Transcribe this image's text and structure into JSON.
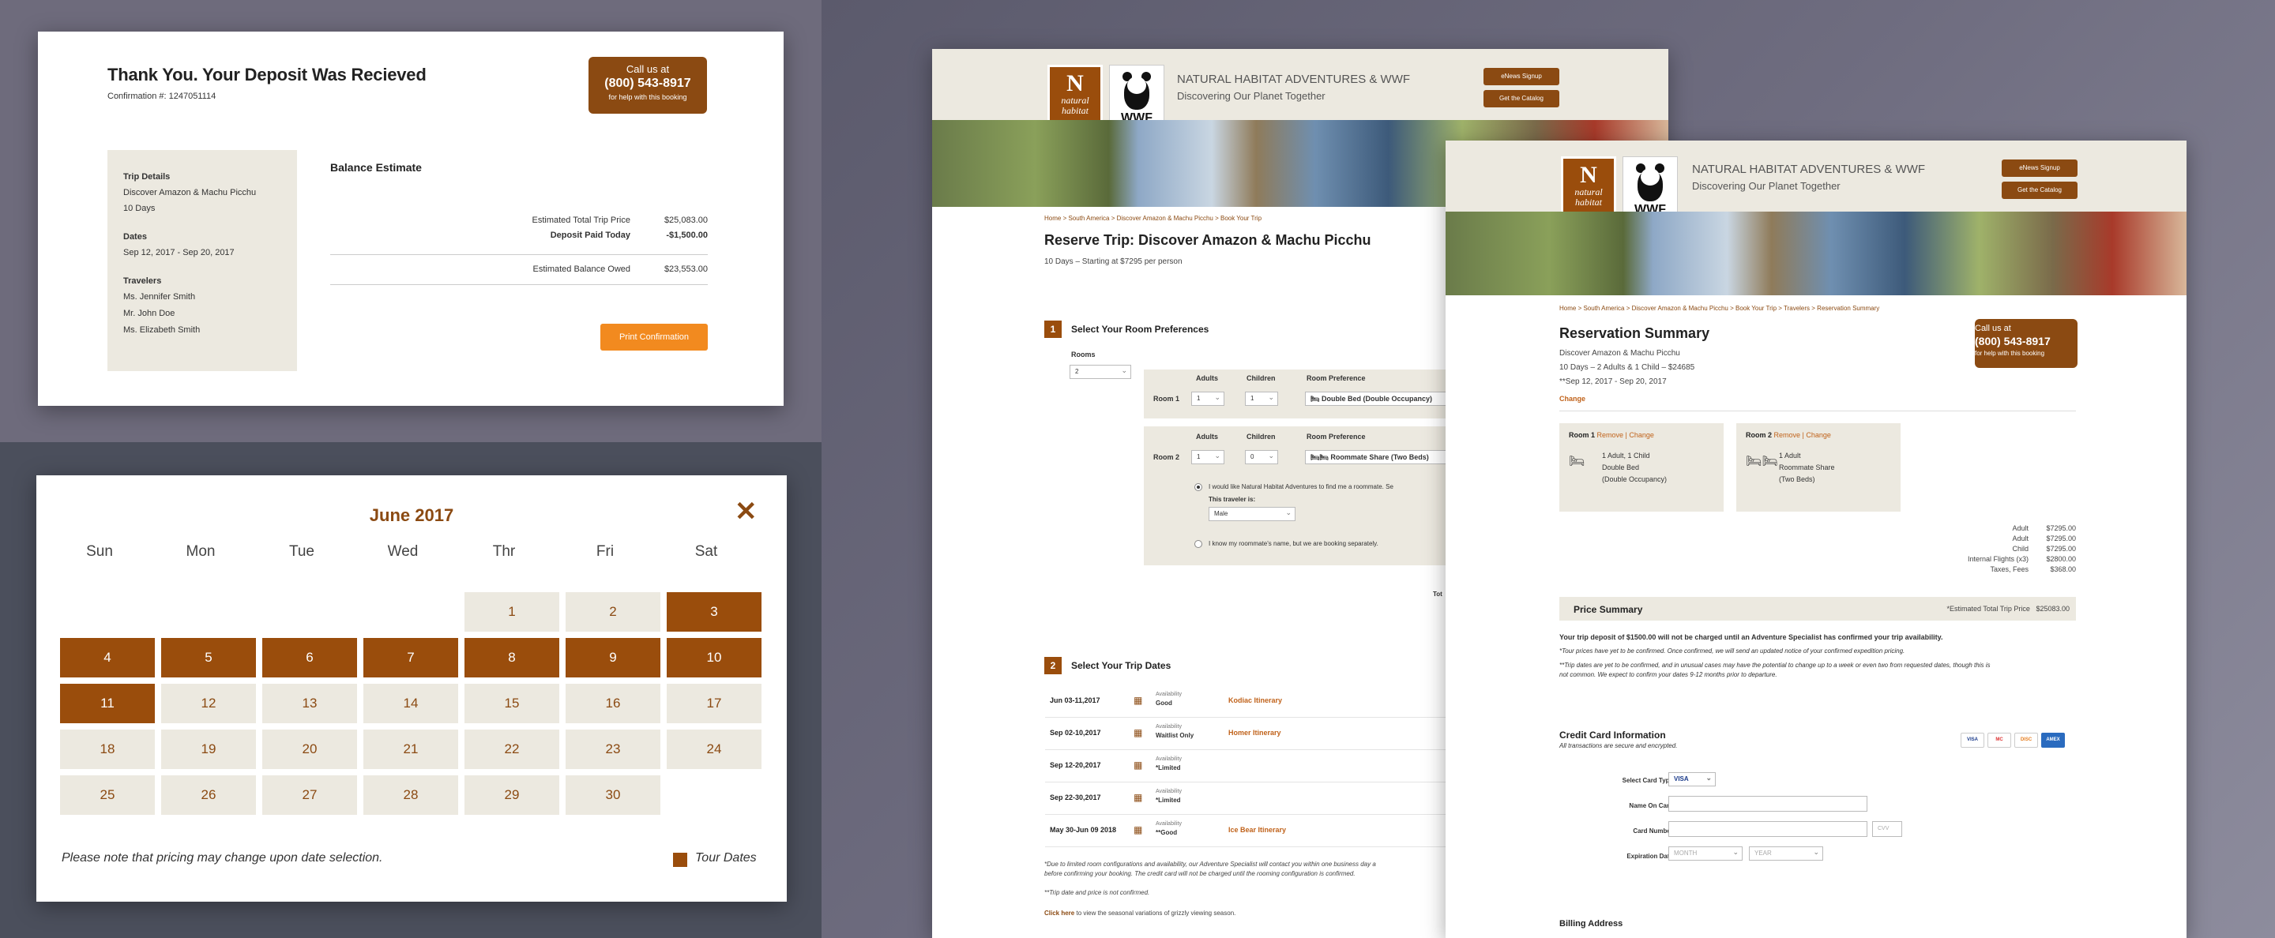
{
  "deposit": {
    "title": "Thank You. Your Deposit Was Recieved",
    "confirmation": "Confirmation #: 1247051114",
    "call": {
      "line1": "Call us at",
      "phone": "(800) 543-8917",
      "line3": "for help with this booking"
    },
    "trip_details_label": "Trip Details",
    "trip_name": "Discover Amazon & Machu Picchu",
    "trip_length": "10 Days",
    "dates_label": "Dates",
    "dates": "Sep 12, 2017 - Sep 20, 2017",
    "travelers_label": "Travelers",
    "travelers": [
      "Ms. Jennifer Smith",
      "Mr. John Doe",
      "Ms. Elizabeth Smith"
    ],
    "balance_title": "Balance Estimate",
    "rows": [
      {
        "label": "Estimated Total Trip Price",
        "value": "$25,083.00"
      },
      {
        "label": "Deposit Paid Today",
        "value": "-$1,500.00"
      },
      {
        "label": "Estimated Balance Owed",
        "value": "$23,553.00"
      }
    ],
    "print_label": "Print Confirmation"
  },
  "calendar": {
    "month": "June 2017",
    "close": "✕",
    "weekdays": [
      "Sun",
      "Mon",
      "Tue",
      "Wed",
      "Thr",
      "Fri",
      "Sat"
    ],
    "days": [
      "1",
      "2",
      "3",
      "4",
      "5",
      "6",
      "7",
      "8",
      "9",
      "10",
      "11",
      "12",
      "13",
      "14",
      "15",
      "16",
      "17",
      "18",
      "19",
      "20",
      "21",
      "22",
      "23",
      "24",
      "25",
      "26",
      "27",
      "28",
      "29",
      "30"
    ],
    "note": "Please note that pricing may change upon date selection.",
    "legend": "Tour Dates"
  },
  "site": {
    "brand_title": "NATURAL HABITAT ADVENTURES & WWF",
    "brand_sub": "Discovering Our Planet Together",
    "enews": "eNews Signup",
    "catalog": "Get the Catalog",
    "logo_n": "N",
    "logo_text": "natural habitat",
    "wwf": "WWF"
  },
  "reserve": {
    "breadcrumb": "Home > South America > Discover Amazon & Machu Picchu > Book Your Trip",
    "title": "Reserve Trip: Discover Amazon & Machu Picchu",
    "subtitle": "10 Days – Starting at $7295 per person",
    "step1": "Select Your Room Preferences",
    "rooms_label": "Rooms",
    "rooms_value": "2",
    "adults_label": "Adults",
    "children_label": "Children",
    "room_pref_label": "Room Preference",
    "room1_label": "Room 1",
    "room1_adults": "1",
    "room1_children": "1",
    "room1_pref": "Double Bed (Double Occupancy)",
    "room2_label": "Room 2",
    "room2_adults": "1",
    "room2_children": "0",
    "room2_pref": "Roommate Share (Two Beds)",
    "roommate_opt1": "I would like Natural Habitat Adventures to find me a roommate. Se",
    "traveler_is": "This traveler is:",
    "traveler_value": "Male",
    "roommate_opt2": "I know my roommate's name, but we are booking separately.",
    "tot": "Tot",
    "step2": "Select Your Trip Dates",
    "availability_label": "Availability",
    "dates": [
      {
        "date": "Jun 03-11,2017",
        "avail": "Good",
        "itin": "Kodiac Itinerary"
      },
      {
        "date": "Sep 02-10,2017",
        "avail": "Waitlist Only",
        "itin": "Homer Itinerary"
      },
      {
        "date": "Sep 12-20,2017",
        "avail": "*Limited",
        "itin": ""
      },
      {
        "date": "Sep 22-30,2017",
        "avail": "*Limited",
        "itin": ""
      },
      {
        "date": "May 30-Jun 09 2018",
        "avail": "**Good",
        "itin": "Ice Bear Itinerary"
      }
    ],
    "fn1": "*Due to limited room configurations and availability, our Adventure Specialist will contact you within one business day a",
    "fn1b": "before confirming your booking. The credit card will not be charged until the rooming configuration is confirmed.",
    "fn2": "**Trip date and price is not confirmed.",
    "click_here": "Click here",
    "fn3": "to view the seasonal variations of grizzly viewing season."
  },
  "summary": {
    "breadcrumb": "Home > South America > Discover Amazon & Machu Picchu > Book Your Trip > Travelers > Reservation Summary",
    "title": "Reservation Summary",
    "call": {
      "line1": "Call us at",
      "phone": "(800) 543-8917",
      "line3": "for help with this booking"
    },
    "trip": "Discover Amazon & Machu Picchu",
    "line2": "10 Days – 2 Adults & 1 Child – $24685",
    "line3": "**Sep 12, 2017 - Sep 20, 2017",
    "change": "Change",
    "room1_title": "Room 1",
    "room1_links": "Remove | Change",
    "room1_lines": [
      "1 Adult, 1 Child",
      "Double Bed",
      "(Double Occupancy)"
    ],
    "room2_title": "Room 2",
    "room2_links": "Remove | Change",
    "room2_lines": [
      "1 Adult",
      "Roommate Share",
      "(Two Beds)"
    ],
    "prices": [
      {
        "label": "Adult",
        "value": "$7295.00"
      },
      {
        "label": "Adult",
        "value": "$7295.00"
      },
      {
        "label": "Child",
        "value": "$7295.00"
      },
      {
        "label": "Internal Flights (x3)",
        "value": "$2800.00"
      },
      {
        "label": "Taxes, Fees",
        "value": "$368.00"
      }
    ],
    "price_summary": "Price Summary",
    "est_total": "*Estimated Total Trip Price",
    "est_total_value": "$25083.00",
    "deposit_note": "Your trip deposit of $1500.00 will not be charged until an Adventure Specialist has confirmed your trip availability.",
    "note2": "*Tour prices have yet to be confirmed. Once confirmed, we will send an updated notice of your confirmed expedition pricing.",
    "note3": "**Trip dates are yet to be confirmed, and in unusual cases may have the potential to change up to a week or even two from requested dates, though this is",
    "note3b": "not common. We expect to confirm your dates 9-12 months prior to departure.",
    "cc_title": "Credit Card Information",
    "cc_sub": "All transactions are secure and encrypted.",
    "card_type_label": "Select Card Type",
    "card_type_value": "VISA",
    "name_label": "Name On Card",
    "number_label": "Card Number",
    "cvv_placeholder": "CVV",
    "exp_label": "Expiration Date",
    "month_placeholder": "MONTH",
    "year_placeholder": "YEAR",
    "cards": [
      "VISA",
      "MC",
      "DISC",
      "AMEX"
    ],
    "billing": "Billing Address"
  },
  "colors": {
    "brand": "#8b4a12",
    "accent": "#f28a1f",
    "panel_bg": "#ece9e0"
  }
}
